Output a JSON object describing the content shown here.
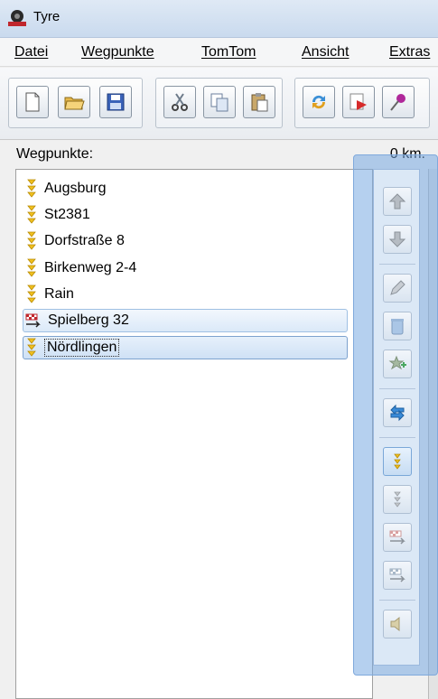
{
  "window": {
    "title": "Tyre",
    "icon": "tyre-app-icon"
  },
  "menu": [
    {
      "label": "Datei"
    },
    {
      "label": "Wegpunkte"
    },
    {
      "label": "TomTom"
    },
    {
      "label": "Ansicht"
    },
    {
      "label": "Extras"
    }
  ],
  "toolbar": {
    "buttons": [
      "new-file-icon",
      "open-folder-icon",
      "save-disk-icon",
      "cut-scissors-icon",
      "copy-icon",
      "paste-icon",
      "refresh-icon",
      "send-icon",
      "pin-icon"
    ]
  },
  "panel": {
    "label": "Wegpunkte:",
    "distance": "0 km."
  },
  "waypoints": [
    {
      "label": "Augsburg",
      "icon": "waypoint-icon"
    },
    {
      "label": "St2381",
      "icon": "waypoint-icon"
    },
    {
      "label": "Dorfstraße 8",
      "icon": "waypoint-icon"
    },
    {
      "label": "Birkenweg 2-4",
      "icon": "waypoint-icon"
    },
    {
      "label": "Rain",
      "icon": "waypoint-icon"
    },
    {
      "label": "Spielberg 32",
      "icon": "finish-flag-icon"
    },
    {
      "label": "Nördlingen",
      "icon": "waypoint-icon"
    }
  ],
  "side_buttons": [
    "move-up-icon",
    "move-down-icon",
    "edit-icon",
    "delete-icon",
    "add-favorite-icon",
    "reverse-route-icon",
    "waypoint-type-icon",
    "via-point-icon",
    "set-destination-icon",
    "set-start-icon",
    "speaker-icon"
  ],
  "colors": {
    "accent": "#7fa9dc",
    "selection": "#cfe1f5",
    "waypoint_icon": "#f0c020"
  }
}
